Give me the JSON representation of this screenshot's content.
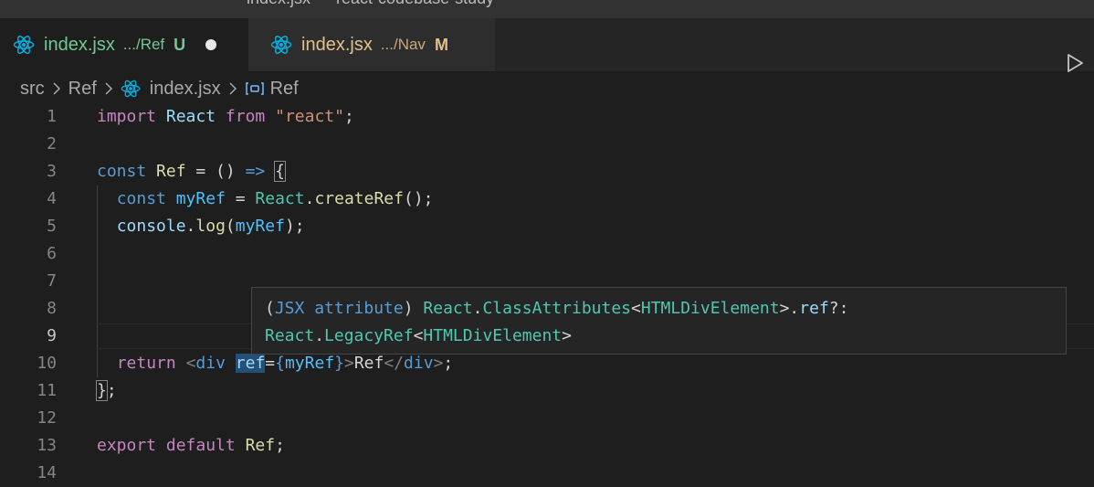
{
  "titlebar": {
    "text": "index.jsx — react-codebase-study"
  },
  "tabs": [
    {
      "name": "index.jsx",
      "path": ".../Ref",
      "status": "U",
      "active": true,
      "dirty": true,
      "color": "#73c991"
    },
    {
      "name": "index.jsx",
      "path": ".../Nav",
      "status": "M",
      "active": false,
      "dirty": false,
      "color": "#e2c08d"
    }
  ],
  "breadcrumb": {
    "items": [
      "src",
      "Ref",
      "index.jsx",
      "Ref"
    ]
  },
  "editor": {
    "line_numbers": [
      "1",
      "2",
      "3",
      "4",
      "5",
      "6",
      "7",
      "8",
      "9",
      "10",
      "11",
      "12",
      "13",
      "14"
    ],
    "current_line": "9",
    "lines": [
      [
        [
          "import",
          "keyword"
        ],
        [
          " ",
          "punct"
        ],
        [
          "React",
          "var"
        ],
        [
          " ",
          "punct"
        ],
        [
          "from",
          "keyword"
        ],
        [
          " ",
          "punct"
        ],
        [
          "\"react\"",
          "string"
        ],
        [
          ";",
          "punct"
        ]
      ],
      [],
      [
        [
          "const",
          "storage"
        ],
        [
          " ",
          "punct"
        ],
        [
          "Ref",
          "func"
        ],
        [
          " = () ",
          "punct"
        ],
        [
          "=>",
          "storage"
        ],
        [
          " ",
          "punct"
        ],
        [
          "{",
          "bracket"
        ]
      ],
      [
        [
          "  ",
          "punct"
        ],
        [
          "const",
          "storage"
        ],
        [
          " ",
          "punct"
        ],
        [
          "myRef",
          "const"
        ],
        [
          " = ",
          "punct"
        ],
        [
          "React",
          "type"
        ],
        [
          ".",
          "punct"
        ],
        [
          "createRef",
          "func"
        ],
        [
          "();",
          "punct"
        ]
      ],
      [
        [
          "  ",
          "punct"
        ],
        [
          "console",
          "var"
        ],
        [
          ".",
          "punct"
        ],
        [
          "log",
          "func"
        ],
        [
          "(",
          "punct"
        ],
        [
          "myRef",
          "const"
        ],
        [
          ");",
          "punct"
        ]
      ],
      [],
      [],
      [],
      [],
      [
        [
          "  ",
          "punct"
        ],
        [
          "return",
          "keyword"
        ],
        [
          " ",
          "punct"
        ],
        [
          "<",
          "tag"
        ],
        [
          "div",
          "tagname"
        ],
        [
          " ",
          "punct"
        ],
        [
          "ref",
          "var-hl"
        ],
        [
          "=",
          "punct"
        ],
        [
          "{",
          "storage"
        ],
        [
          "myRef",
          "const"
        ],
        [
          "}",
          "storage"
        ],
        [
          ">",
          "tag"
        ],
        [
          "Ref",
          "punct"
        ],
        [
          "</",
          "tag"
        ],
        [
          "div",
          "tagname"
        ],
        [
          ">",
          "tag"
        ],
        [
          ";",
          "punct"
        ]
      ],
      [
        [
          "}",
          "bracket"
        ],
        [
          ";",
          "punct"
        ]
      ],
      [],
      [
        [
          "export",
          "keyword"
        ],
        [
          " ",
          "punct"
        ],
        [
          "default",
          "keyword"
        ],
        [
          " ",
          "punct"
        ],
        [
          "Ref",
          "func"
        ],
        [
          ";",
          "punct"
        ]
      ],
      []
    ]
  },
  "hover": {
    "lines": [
      [
        [
          "(",
          "punct"
        ],
        [
          "JSX attribute",
          "storage"
        ],
        [
          ") ",
          "punct"
        ],
        [
          "React",
          "type"
        ],
        [
          ".",
          "punct"
        ],
        [
          "ClassAttributes",
          "type"
        ],
        [
          "<",
          "punct"
        ],
        [
          "HTMLDivElement",
          "type"
        ],
        [
          ">.",
          "punct"
        ],
        [
          "ref",
          "var"
        ],
        [
          "?:",
          "punct"
        ]
      ],
      [
        [
          "React",
          "type"
        ],
        [
          ".",
          "punct"
        ],
        [
          "LegacyRef",
          "type"
        ],
        [
          "<",
          "punct"
        ],
        [
          "HTMLDivElement",
          "type"
        ],
        [
          ">",
          "punct"
        ]
      ]
    ]
  },
  "colors": {
    "background": "#1e1e1e",
    "tabbar": "#252526",
    "titlebar": "#323233",
    "react_icon": "#00b3e6"
  }
}
